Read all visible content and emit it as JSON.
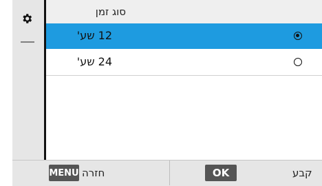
{
  "screen": {
    "title": "סוג זמן"
  },
  "options": [
    {
      "label": "12 שע'",
      "selected": true
    },
    {
      "label": "24 שע'",
      "selected": false
    }
  ],
  "sidebar": {
    "icon": "gear-icon"
  },
  "footer": {
    "menu_key": "MENU",
    "back_label": "חזרה",
    "ok_key": "OK",
    "set_label": "קבע"
  },
  "colors": {
    "selected_row": "#1e9be0",
    "panel": "#e6e6e6",
    "title_bar": "#efefef"
  }
}
